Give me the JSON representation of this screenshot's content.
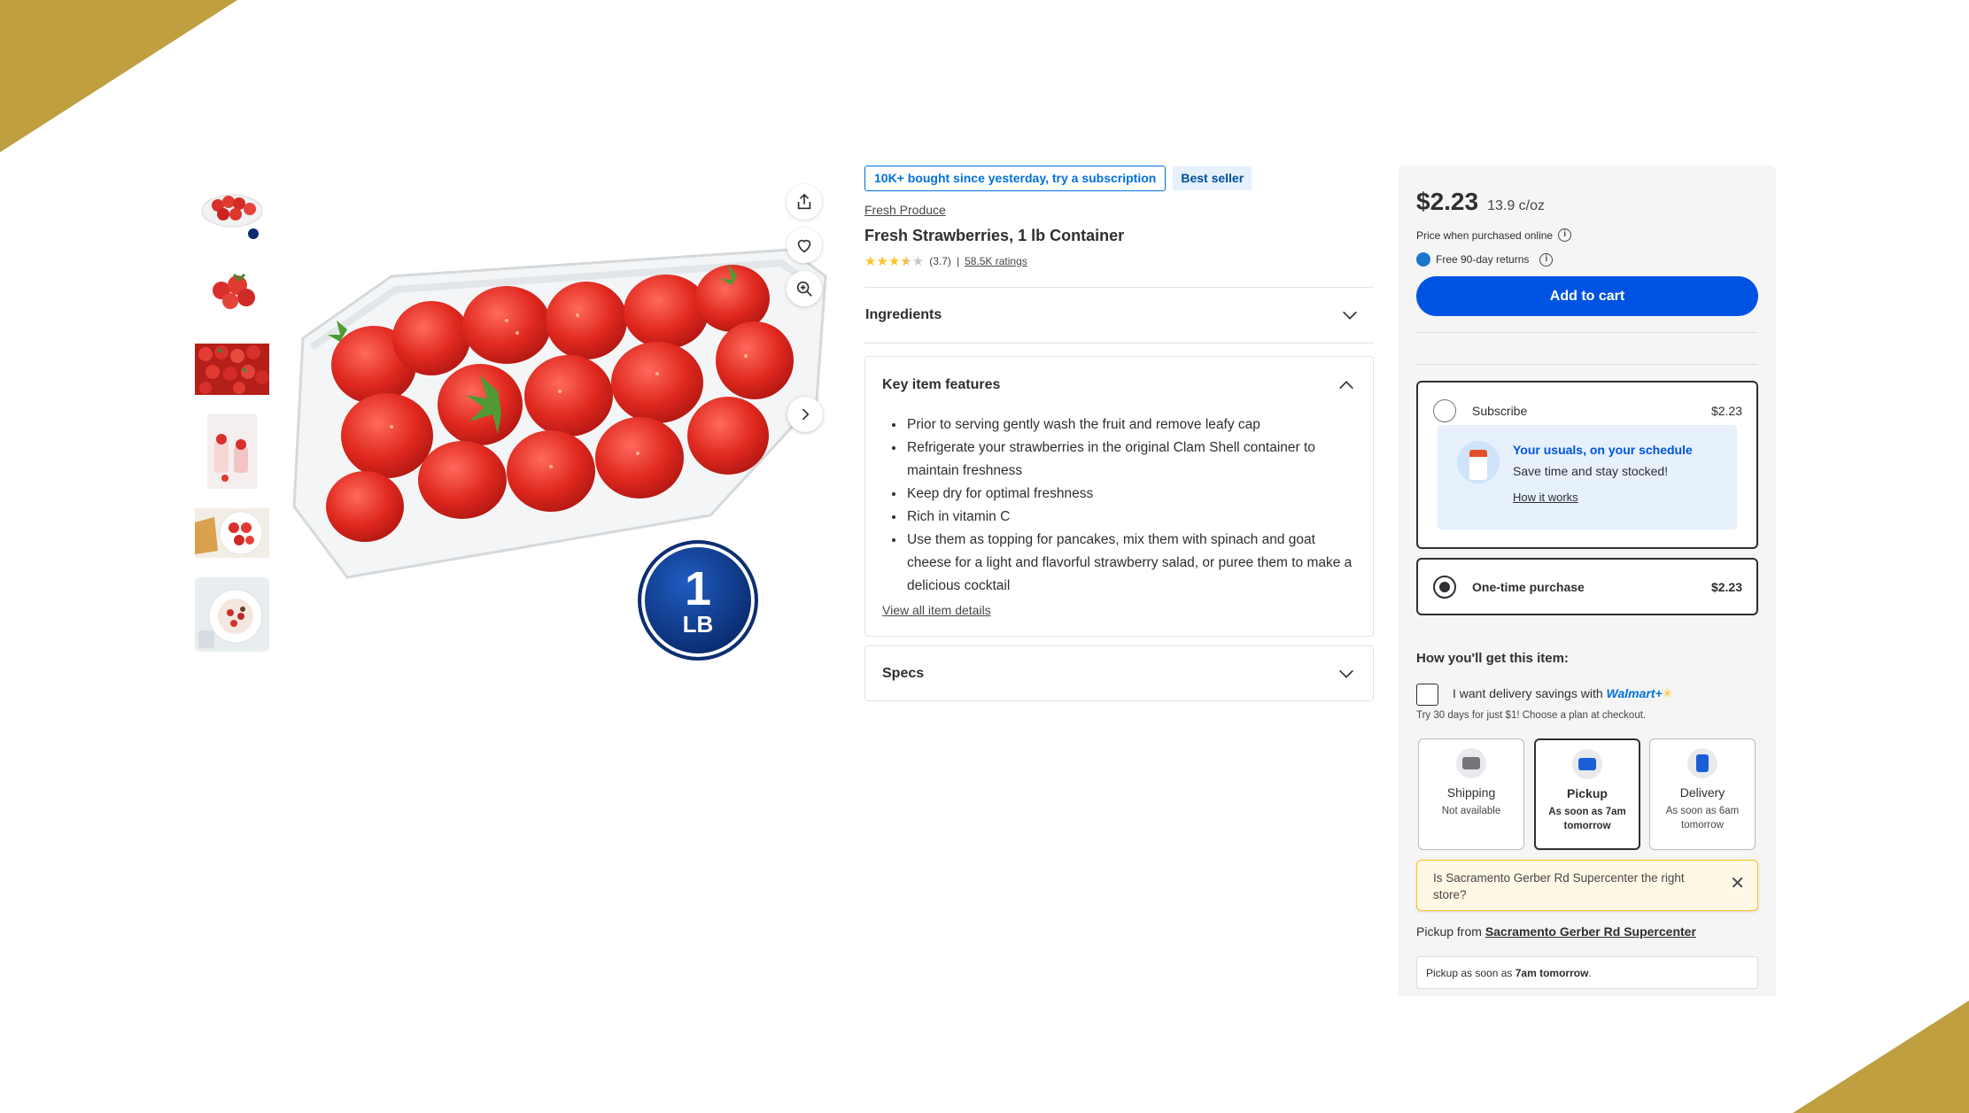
{
  "badges": {
    "subscription_nudge": "10K+ bought since yesterday, try a subscription",
    "best_seller": "Best seller"
  },
  "product": {
    "brand": "Fresh Produce",
    "title": "Fresh Strawberries, 1 lb Container",
    "rating_value": "(3.7)",
    "rating_separator": "|",
    "ratings_count": "58.5K ratings",
    "rating": 3.7,
    "image_badge": {
      "number": "1",
      "unit": "LB"
    }
  },
  "image_actions": {
    "share_icon": "share-icon",
    "favorite_icon": "heart-icon",
    "zoom_icon": "zoom-in-icon",
    "next_icon": "chevron-right-icon"
  },
  "sections": {
    "ingredients": "Ingredients",
    "key_features": "Key item features",
    "specs": "Specs",
    "view_all": "View all item details"
  },
  "features": [
    "Prior to serving gently wash the fruit and remove leafy cap",
    "Refrigerate your strawberries in the original Clam Shell container to maintain freshness",
    "Keep dry for optimal freshness",
    "Rich in vitamin C",
    "Use them as topping for pancakes, mix them with spinach and goat cheese for a light and flavorful strawberry salad, or puree them to make a delicious cocktail"
  ],
  "buy_box": {
    "price": "$2.23",
    "unit_price": "13.9 c/oz",
    "price_note": "Price when purchased online",
    "returns": "Free 90-day returns",
    "add_to_cart": "Add to cart",
    "subscribe_label": "Subscribe",
    "subscribe_price": "$2.23",
    "promo_title": "Your usuals, on your schedule",
    "promo_sub": "Save time and stay stocked!",
    "promo_link": "How it works",
    "onetime_label": "One-time purchase",
    "onetime_price": "$2.23",
    "how_title": "How you'll get this item:",
    "savings_prefix": "I want delivery savings with",
    "walmart_plus": "Walmart+",
    "trial": "Try 30 days for just $1! Choose a plan at checkout.",
    "fulfillment": [
      {
        "title": "Shipping",
        "sub": "Not available",
        "icon": "truck-icon"
      },
      {
        "title": "Pickup",
        "sub": "As soon as 7am tomorrow",
        "icon": "car-icon"
      },
      {
        "title": "Delivery",
        "sub": "As soon as 6am tomorrow",
        "icon": "bag-icon"
      }
    ],
    "store_alert": "Is Sacramento Gerber Rd Supercenter the right store?",
    "pickup_from_label": "Pickup from",
    "pickup_store": "Sacramento Gerber Rd Supercenter",
    "pickup_time_prefix": "Pickup as soon as",
    "pickup_time": "7am tomorrow",
    "pickup_time_suffix": "."
  },
  "colors": {
    "accent": "#0053e2",
    "corner": "#bf9f3f",
    "star": "#ffc220"
  }
}
